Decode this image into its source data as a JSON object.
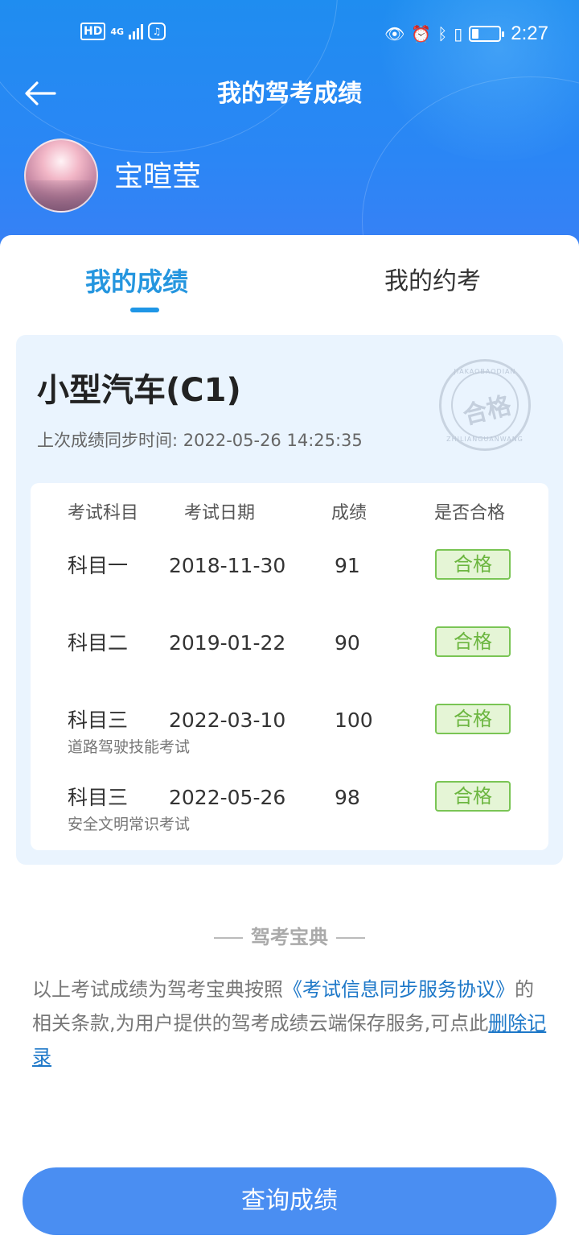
{
  "status_bar": {
    "hd": "HD",
    "network": "4G",
    "time": "2:27"
  },
  "header": {
    "title": "我的驾考成绩",
    "username": "宝暄莹"
  },
  "tabs": [
    {
      "label": "我的成绩",
      "active": true
    },
    {
      "label": "我的约考",
      "active": false
    }
  ],
  "card": {
    "vehicle_type": "小型汽车(C1)",
    "sync_time": "上次成绩同步时间: 2022-05-26 14:25:35",
    "stamp": {
      "text": "合格",
      "top": "JIAKAOBAODIAN",
      "bottom": "ZHILIANGUANWANG"
    }
  },
  "table": {
    "headers": [
      "考试科目",
      "考试日期",
      "成绩",
      "是否合格"
    ],
    "rows": [
      {
        "subject": "科目一",
        "date": "2018-11-30",
        "score": "91",
        "result": "合格",
        "note": ""
      },
      {
        "subject": "科目二",
        "date": "2019-01-22",
        "score": "90",
        "result": "合格",
        "note": ""
      },
      {
        "subject": "科目三",
        "date": "2022-03-10",
        "score": "100",
        "result": "合格",
        "note": "道路驾驶技能考试"
      },
      {
        "subject": "科目三",
        "date": "2022-05-26",
        "score": "98",
        "result": "合格",
        "note": "安全文明常识考试"
      }
    ]
  },
  "footer": {
    "brand": "驾考宝典",
    "desc_prefix": "以上考试成绩为驾考宝典按照",
    "desc_link": "《考试信息同步服务协议》",
    "desc_middle": "的相关条款,为用户提供的驾考成绩云端保存服务,可点此",
    "desc_delete": "删除记录"
  },
  "button": {
    "label": "查询成绩"
  },
  "colors": {
    "header_blue": "#2b86f5",
    "tab_active": "#2596df",
    "card_bg": "#eaf4fe",
    "badge_green": "#6cb640",
    "button_blue": "#4a8ef2",
    "link_blue": "#1e78c8"
  }
}
